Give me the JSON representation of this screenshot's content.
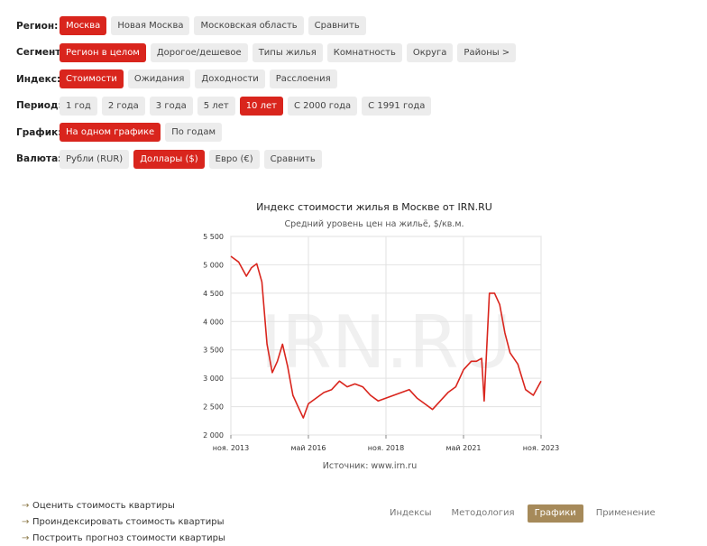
{
  "filters": [
    {
      "label": "Регион:",
      "options": [
        "Москва",
        "Новая Москва",
        "Московская область",
        "Сравнить"
      ],
      "active": 0
    },
    {
      "label": "Сегмент:",
      "options": [
        "Регион в целом",
        "Дорогое/дешевое",
        "Типы жилья",
        "Комнатность",
        "Округа",
        "Районы >"
      ],
      "active": 0
    },
    {
      "label": "Индекс:",
      "options": [
        "Стоимости",
        "Ожидания",
        "Доходности",
        "Расслоения"
      ],
      "active": 0
    },
    {
      "label": "Период:",
      "options": [
        "1 год",
        "2 года",
        "3 года",
        "5 лет",
        "10 лет",
        "С 2000 года",
        "С 1991 года"
      ],
      "active": 4
    },
    {
      "label": "График:",
      "options": [
        "На одном графике",
        "По годам"
      ],
      "active": 0
    },
    {
      "label": "Валюта:",
      "options": [
        "Рубли (RUR)",
        "Доллары ($)",
        "Евро (€)",
        "Сравнить"
      ],
      "active": 1
    }
  ],
  "chart_data": {
    "type": "line",
    "title": "Индекс стоимости жилья в Москве от IRN.RU",
    "subtitle": "Средний уровень цен на жильё, $/кв.м.",
    "watermark": "IRN.RU",
    "source": "Источник: www.irn.ru",
    "x_tick_labels": [
      "ноя. 2013",
      "май 2016",
      "ноя. 2018",
      "май 2021",
      "ноя. 2023"
    ],
    "x_range": [
      "2013-11",
      "2023-11"
    ],
    "ylim": [
      2000,
      5500
    ],
    "y_ticks": [
      2000,
      2500,
      3000,
      3500,
      4000,
      4500,
      5000,
      5500
    ],
    "y_tick_labels": [
      "2 000",
      "2 500",
      "3 000",
      "3 500",
      "4 000",
      "4 500",
      "5 000",
      "5 500"
    ],
    "grid": true,
    "line_color": "#d9251d",
    "series": [
      {
        "x": [
          "2013-11",
          "2014-02",
          "2014-05",
          "2014-07",
          "2014-09",
          "2014-11",
          "2015-01",
          "2015-03",
          "2015-05",
          "2015-07",
          "2015-09",
          "2015-11",
          "2016-01",
          "2016-03",
          "2016-05",
          "2016-08",
          "2016-11",
          "2017-02",
          "2017-05",
          "2017-08",
          "2017-11",
          "2018-02",
          "2018-05",
          "2018-08",
          "2018-11",
          "2019-02",
          "2019-05",
          "2019-08",
          "2019-11",
          "2020-02",
          "2020-05",
          "2020-08",
          "2020-11",
          "2021-02",
          "2021-05",
          "2021-08",
          "2021-10",
          "2021-12",
          "2022-01",
          "2022-03",
          "2022-05",
          "2022-07",
          "2022-09",
          "2022-11",
          "2023-02",
          "2023-05",
          "2023-08",
          "2023-11"
        ],
        "values": [
          5150,
          5050,
          4800,
          4950,
          5020,
          4700,
          3600,
          3100,
          3300,
          3600,
          3200,
          2700,
          2500,
          2300,
          2550,
          2650,
          2750,
          2800,
          2950,
          2850,
          2900,
          2850,
          2700,
          2600,
          2650,
          2700,
          2750,
          2800,
          2650,
          2550,
          2450,
          2600,
          2750,
          2850,
          3150,
          3300,
          3300,
          3350,
          2600,
          4500,
          4500,
          4300,
          3800,
          3450,
          3250,
          2800,
          2700,
          2950
        ]
      }
    ]
  },
  "links": [
    {
      "label": "Оценить стоимость квартиры"
    },
    {
      "label": "Проиндексировать стоимость квартиры"
    },
    {
      "label": "Построить прогноз стоимости квартиры"
    }
  ],
  "tabs": [
    {
      "label": "Индексы"
    },
    {
      "label": "Методология"
    },
    {
      "label": "Графики",
      "active": true
    },
    {
      "label": "Применение"
    }
  ],
  "icons": {
    "link_arrow": "arrow-right-icon"
  }
}
